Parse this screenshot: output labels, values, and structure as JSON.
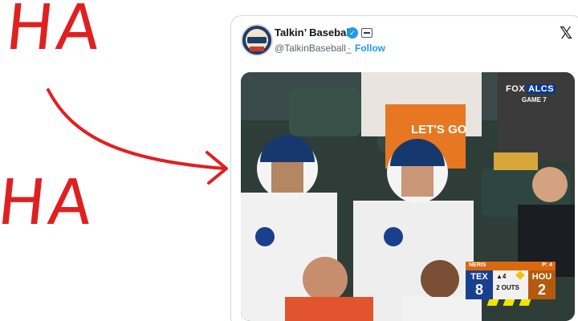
{
  "doodle": {
    "top_text": "HA",
    "bottom_text": "HA",
    "ink_color": "#e02020"
  },
  "tweet": {
    "author_name": "Talkin’ Baseball",
    "handle": "@TalkinBaseball_",
    "separator": "·",
    "follow_label": "Follow",
    "verified": true,
    "platform_icon": "x-logo",
    "brand_color": "#1d9bf0"
  },
  "media": {
    "broadcast": {
      "network": "FOX",
      "league": "ALCS",
      "game_label": "GAME 7"
    },
    "sign_text": "LET'S GO",
    "scoreboard": {
      "batter": "NERIS",
      "pitch_count": "P: 4",
      "away_team": "TEX",
      "away_score": "8",
      "home_team": "HOU",
      "home_score": "2",
      "inning": "▲4",
      "outs": "2 OUTS"
    }
  }
}
